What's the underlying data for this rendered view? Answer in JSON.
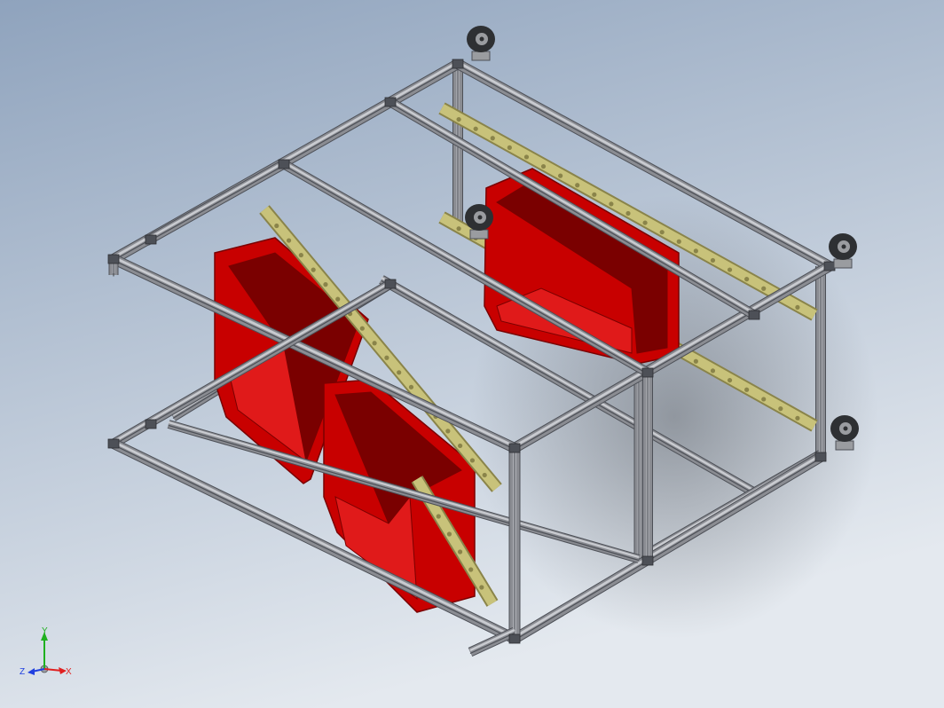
{
  "viewport": {
    "background_top": "#8fa3bd",
    "background_bottom": "#e4e9ef"
  },
  "model": {
    "name": "",
    "colors": {
      "frame": "#8a8c92",
      "frame_dark": "#4d5057",
      "frame_light": "#c9cbd0",
      "bin": "#c80000",
      "bin_dark": "#7a0000",
      "bin_light": "#e01a1a",
      "rail": "#c8c27a",
      "rail_dark": "#8a844a",
      "caster": "#2e3033",
      "caster_hub": "#9a9ca0"
    },
    "parts": {
      "caster_count": 4,
      "bin_count": 3,
      "rail_count": 4
    }
  },
  "triad": {
    "x_label": "X",
    "y_label": "Y",
    "z_label": "Z",
    "x_color": "#e02020",
    "y_color": "#20b020",
    "z_color": "#2040e0"
  }
}
